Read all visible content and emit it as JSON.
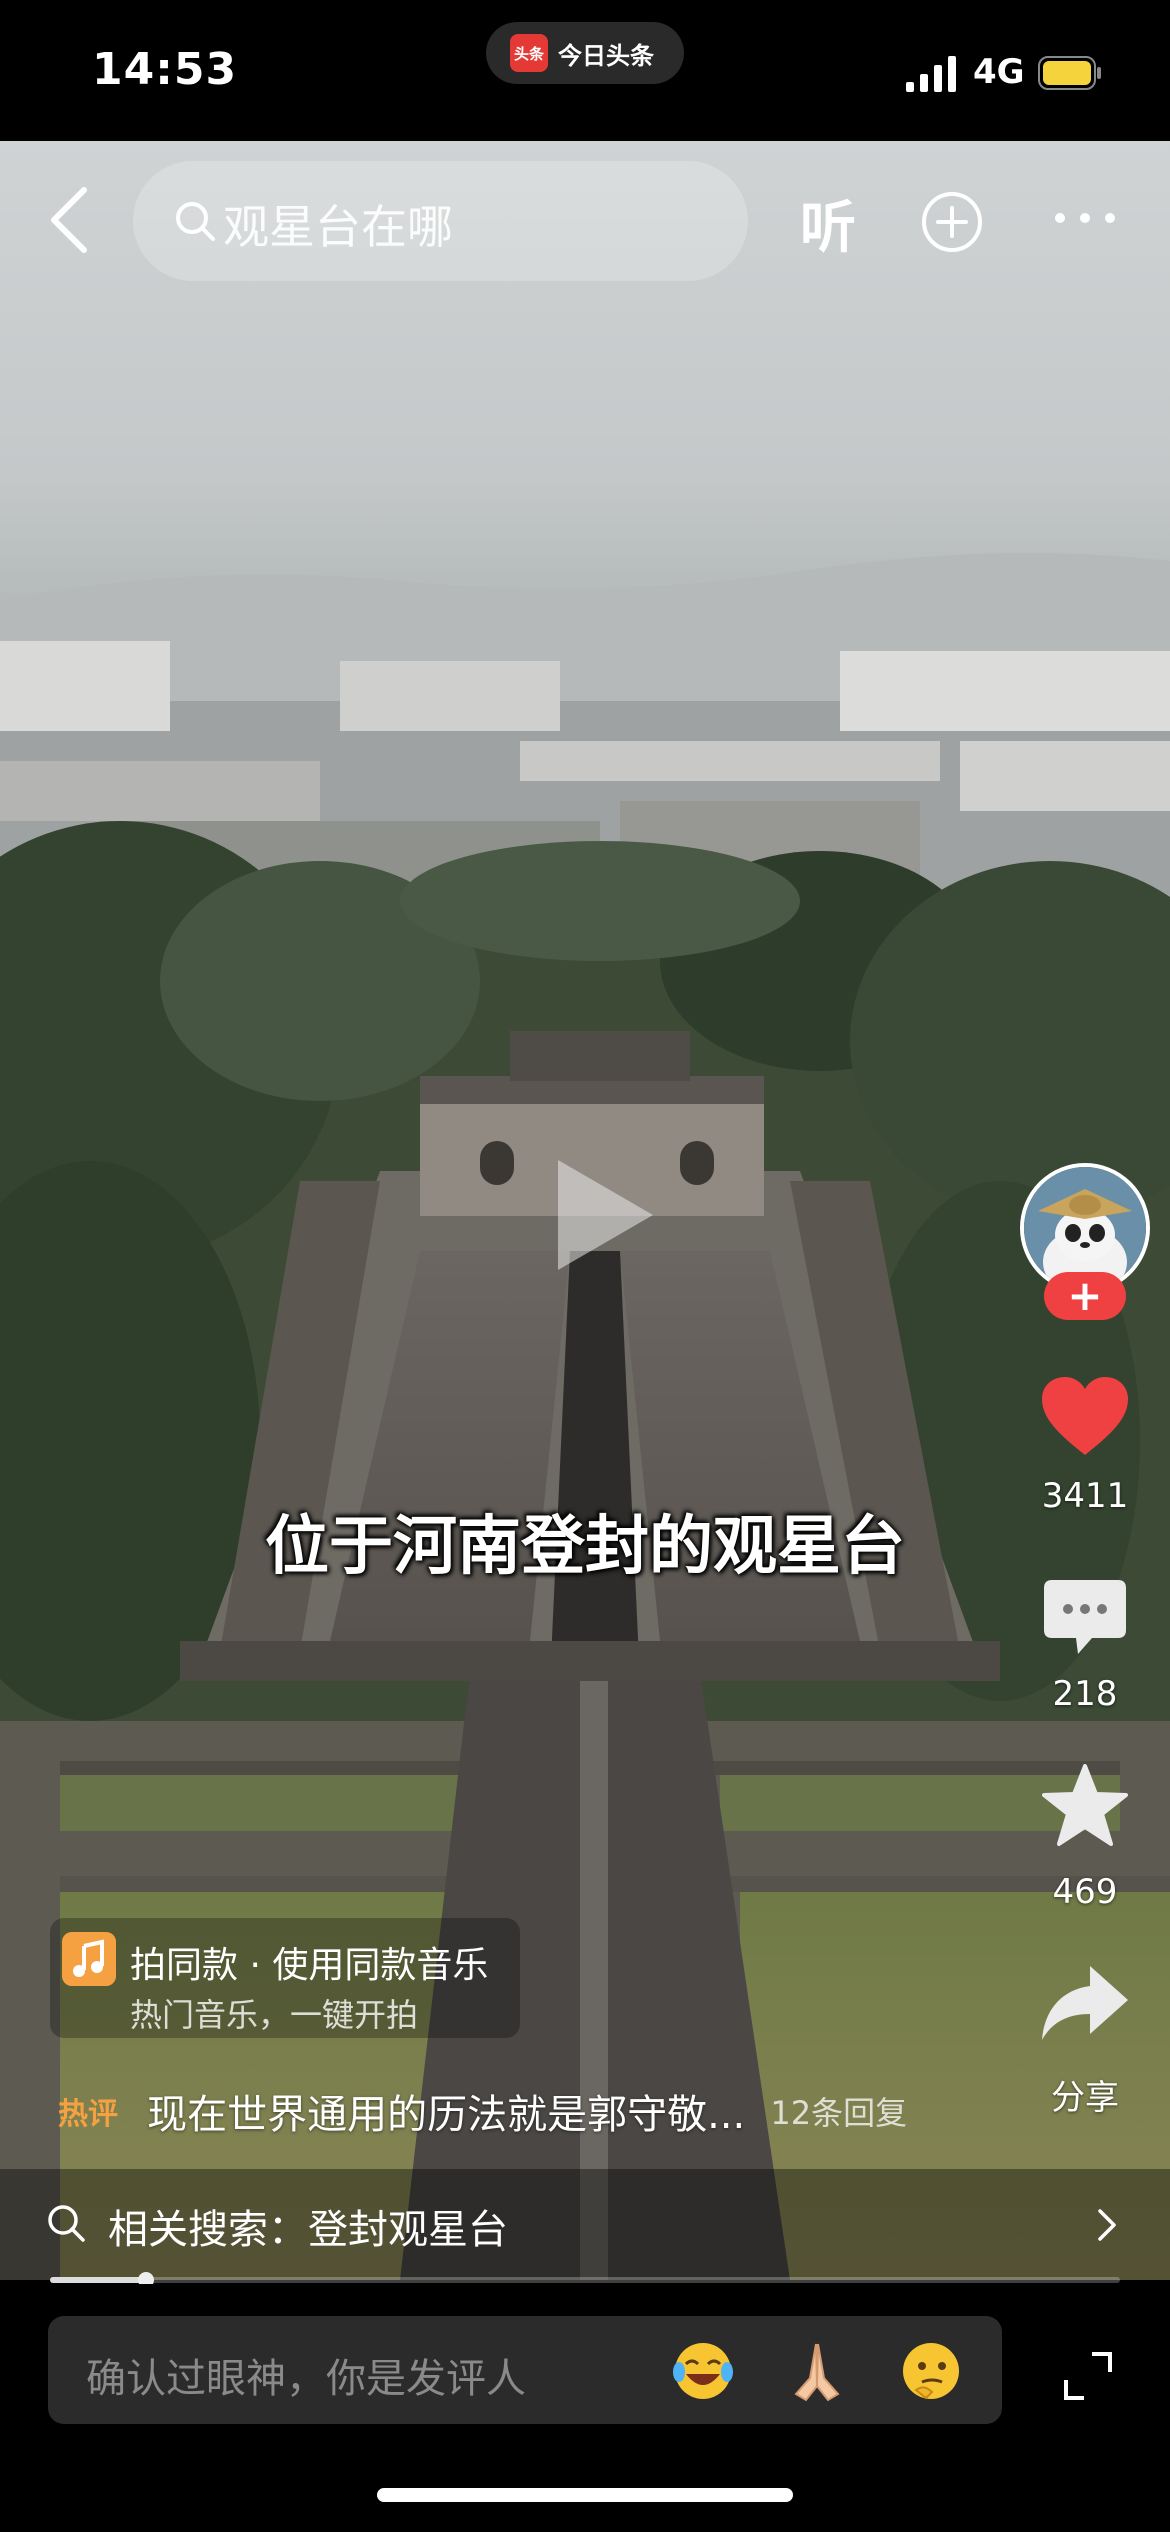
{
  "status_bar": {
    "time": "14:53",
    "app_name": "今日头条",
    "app_logo_text": "头条",
    "network": "4G",
    "battery_color": "#f5d33d"
  },
  "top_bar": {
    "search_query": "观星台在哪",
    "listen_label": "听",
    "icons": [
      "back-icon",
      "search-icon",
      "add-circle-icon",
      "more-icon"
    ]
  },
  "video": {
    "caption": "位于河南登封的观星台",
    "progress": 0.09
  },
  "actions": {
    "like_count": "3411",
    "comment_count": "218",
    "favorite_count": "469",
    "share_label": "分享",
    "like_color": "#f04142",
    "follow_label": "+"
  },
  "music": {
    "title": "拍同款 · 使用同款音乐",
    "subtitle": "热门音乐，一键开拍",
    "accent": "#f5a142"
  },
  "hot_comment": {
    "tag": "热评",
    "text": "现在世界通用的历法就是郭守敬...",
    "replies": "12条回复"
  },
  "related_search": {
    "label": "相关搜索：登封观星台"
  },
  "comment_bar": {
    "placeholder": "确认过眼神，你是发评人",
    "emojis": [
      "laughing-crying-emoji",
      "praying-hands-emoji",
      "thinking-emoji"
    ]
  }
}
